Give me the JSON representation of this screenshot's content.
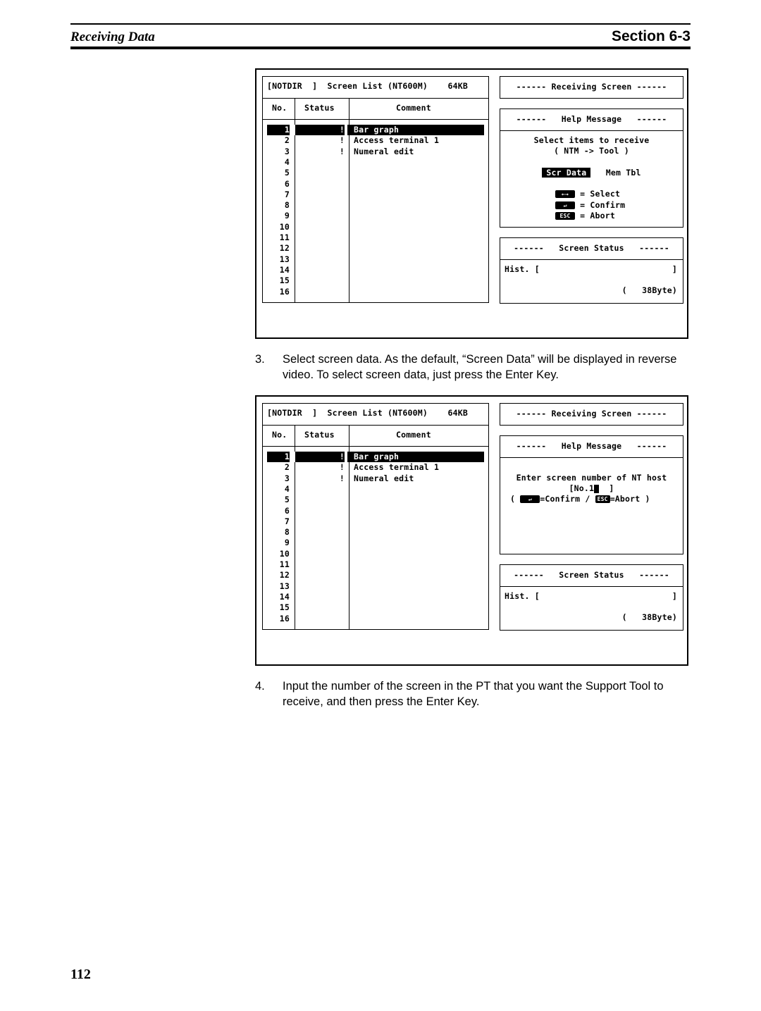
{
  "header": {
    "section_title": "Receiving Data",
    "section_number": "Section 6-3"
  },
  "screens": [
    {
      "list_title": "[NOTDIR  ]  Screen List (NT600M)    64KB",
      "columns": [
        "No.",
        "Status",
        "Comment"
      ],
      "rows": [
        {
          "no": "1",
          "status": "!",
          "comment": "Bar graph",
          "selected": true
        },
        {
          "no": "2",
          "status": "!",
          "comment": "Access terminal 1"
        },
        {
          "no": "3",
          "status": "!",
          "comment": "Numeral edit"
        },
        {
          "no": "4"
        },
        {
          "no": "5"
        },
        {
          "no": "6"
        },
        {
          "no": "7"
        },
        {
          "no": "8"
        },
        {
          "no": "9"
        },
        {
          "no": "10"
        },
        {
          "no": "11"
        },
        {
          "no": "12"
        },
        {
          "no": "13"
        },
        {
          "no": "14"
        },
        {
          "no": "15"
        },
        {
          "no": "16"
        }
      ],
      "receiving_title": "------ Receiving Screen ------",
      "help_title": "------   Help Message   ------",
      "help_lines": [
        "Select items to receive",
        "( NTM -> Tool )"
      ],
      "options": [
        "Scr Data",
        "Mem Tbl"
      ],
      "keys": [
        {
          "key": "←→",
          "label": "= Select"
        },
        {
          "key": "↵",
          "label": "= Confirm"
        },
        {
          "key": "ESC",
          "label": "= Abort"
        }
      ],
      "status_title": "------   Screen Status   ------",
      "hist": "Hist. [",
      "hist_end": "]",
      "size": "(   38Byte)"
    },
    {
      "list_title": "[NOTDIR  ]  Screen List (NT600M)    64KB",
      "columns": [
        "No.",
        "Status",
        "Comment"
      ],
      "rows": [
        {
          "no": "1",
          "status": "!",
          "comment": "Bar graph",
          "selected": true
        },
        {
          "no": "2",
          "status": "!",
          "comment": "Access terminal 1"
        },
        {
          "no": "3",
          "status": "!",
          "comment": "Numeral edit"
        },
        {
          "no": "4"
        },
        {
          "no": "5"
        },
        {
          "no": "6"
        },
        {
          "no": "7"
        },
        {
          "no": "8"
        },
        {
          "no": "9"
        },
        {
          "no": "10"
        },
        {
          "no": "11"
        },
        {
          "no": "12"
        },
        {
          "no": "13"
        },
        {
          "no": "14"
        },
        {
          "no": "15"
        },
        {
          "no": "16"
        }
      ],
      "receiving_title": "------ Receiving Screen ------",
      "help_title": "------   Help Message   ------",
      "help_lines": [
        "Enter screen number of NT host"
      ],
      "input_prefix": "[No.1",
      "input_suffix": "  ]",
      "confirm_key": "↵",
      "confirm_label": "=Confirm /",
      "abort_key": "ESC",
      "abort_label": "=Abort )",
      "paren_open": "(",
      "status_title": "------   Screen Status   ------",
      "hist": "Hist. [",
      "hist_end": "]",
      "size": "(   38Byte)"
    }
  ],
  "steps": [
    {
      "number": "3.",
      "text": "Select screen data. As the default, “Screen Data” will be displayed in reverse video. To select screen data, just press the Enter Key."
    },
    {
      "number": "4.",
      "text": "Input the number of the screen in the PT that you want the Support Tool to receive, and then press the Enter Key."
    }
  ],
  "page_number": "112"
}
